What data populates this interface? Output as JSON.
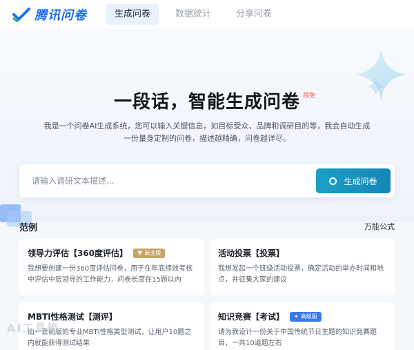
{
  "header": {
    "logo_text": "腾讯问卷",
    "tabs": [
      {
        "label": "生成问卷",
        "active": true
      },
      {
        "label": "数据统计",
        "active": false
      },
      {
        "label": "分享问卷",
        "active": false
      }
    ]
  },
  "hero": {
    "title": "一段话，智能生成问卷",
    "badge": "限免",
    "description": "我是一个问卷AI生成系统，您可以输入关键信息，如目标受众、品牌和调研目的等，我会自动生成一份量身定制的问卷，描述越精确，问卷越详尽。"
  },
  "search": {
    "placeholder": "请输入调研文本描述...",
    "value": "",
    "button_label": "生成问卷"
  },
  "examples": {
    "title": "范例",
    "link": "万能公式",
    "cards": [
      {
        "title": "领导力评估【360度评估】",
        "badge": "商业版",
        "desc": "我想要创建一份360度评估问卷，用于在年底绩效考核中评估中层领导的工作能力，问卷长度在15题以内"
      },
      {
        "title": "活动投票【投票】",
        "badge": "",
        "desc": "我想发起一个班级活动投票，确定活动的举办时间和地点，并征集大家的建议"
      },
      {
        "title": "MBTI性格测试【测评】",
        "badge": "",
        "desc": "出一套简版的专业MBTI性格类型测试，让用户10题之内就能获得测试结果"
      },
      {
        "title": "知识竞赛【考试】",
        "badge": "高级版",
        "desc": "请为我设计一份关于中国传统节日主题的知识竞赛题目，一共10道题左右"
      }
    ]
  },
  "watermark": "AI工具箱",
  "colors": {
    "brand": "#1a6ef5",
    "button": "#1686b7",
    "badge_business": "#c9a46a",
    "badge_advanced": "#3a78e8",
    "badge_free": "#f0584a"
  }
}
